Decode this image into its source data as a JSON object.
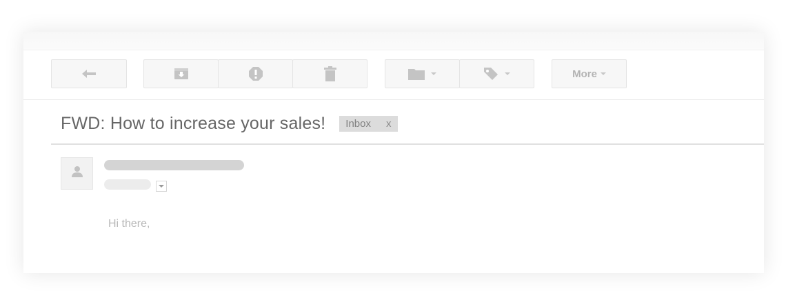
{
  "toolbar": {
    "more_label": "More",
    "icons": {
      "reply": "reply-icon",
      "archive": "archive-icon",
      "spam": "report-spam-icon",
      "delete": "trash-icon",
      "move": "folder-icon",
      "labels": "tag-icon"
    }
  },
  "message": {
    "subject": "FWD: How to increase your sales!",
    "label": "Inbox",
    "label_remove": "x",
    "greeting": "Hi there,"
  },
  "colors": {
    "icon_gray": "#bdbdbd",
    "chip_bg": "#dcdcdc",
    "subject_text": "#666666"
  }
}
